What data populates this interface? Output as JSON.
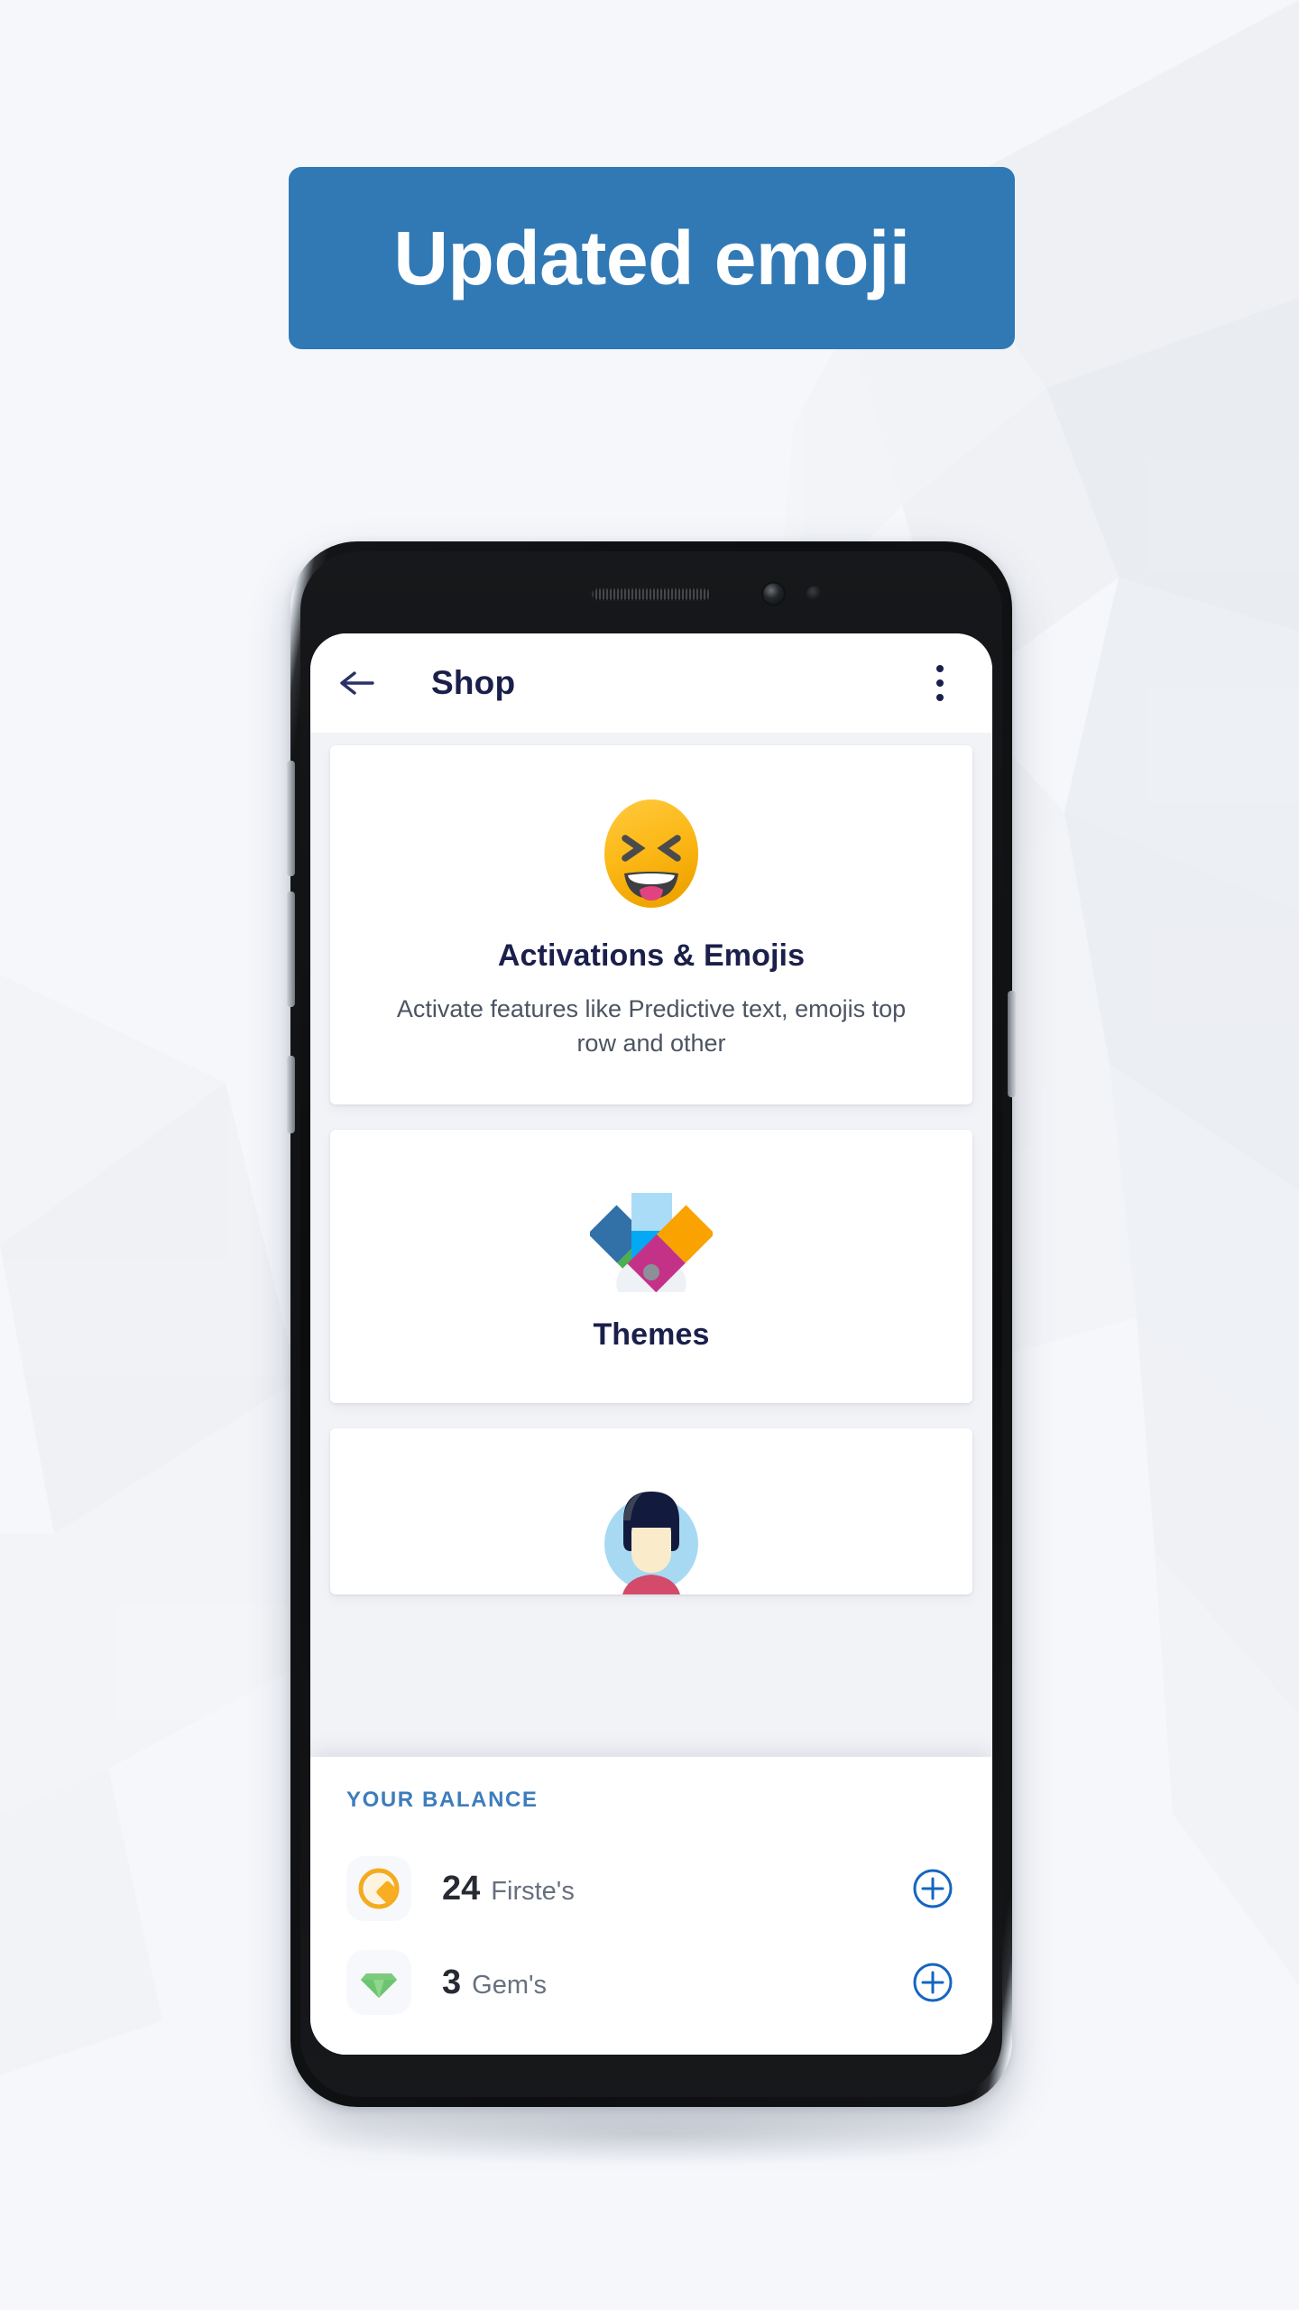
{
  "page": {
    "background_color": "#f5f7fb",
    "accent_blue": "#3179b5"
  },
  "banner": {
    "text": "Updated emoji",
    "background_color": "#3179b5",
    "text_color": "#ffffff"
  },
  "phone": {
    "hardware": {
      "earpiece": "earpiece-speaker",
      "front_camera": "front-camera",
      "proximity_sensor": "proximity-sensor",
      "volume_up": "volume-up-button",
      "volume_down": "volume-down-button",
      "bixby": "bixby-button",
      "power": "power-button"
    }
  },
  "appbar": {
    "back_icon": "back-arrow-icon",
    "title": "Shop",
    "overflow_icon": "overflow-menu-icon",
    "title_color": "#1a1f4b"
  },
  "cards": [
    {
      "id": "activations-emojis",
      "icon": "laughing-emoji-icon",
      "title": "Activations & Emojis",
      "description": "Activate features like Predictive text, emojis top row and  other"
    },
    {
      "id": "themes",
      "icon": "color-swatch-fan-icon",
      "title": "Themes",
      "description": ""
    },
    {
      "id": "avatar",
      "icon": "person-avatar-icon",
      "title": "",
      "description": ""
    }
  ],
  "balance": {
    "heading": "YOUR BALANCE",
    "heading_color": "#3d7dbe",
    "rows": [
      {
        "icon": "coin-icon",
        "amount": "24",
        "unit": "Firste's",
        "add_icon": "plus-circle-icon"
      },
      {
        "icon": "gem-icon",
        "amount": "3",
        "unit": "Gem's",
        "add_icon": "plus-circle-icon"
      }
    ]
  }
}
